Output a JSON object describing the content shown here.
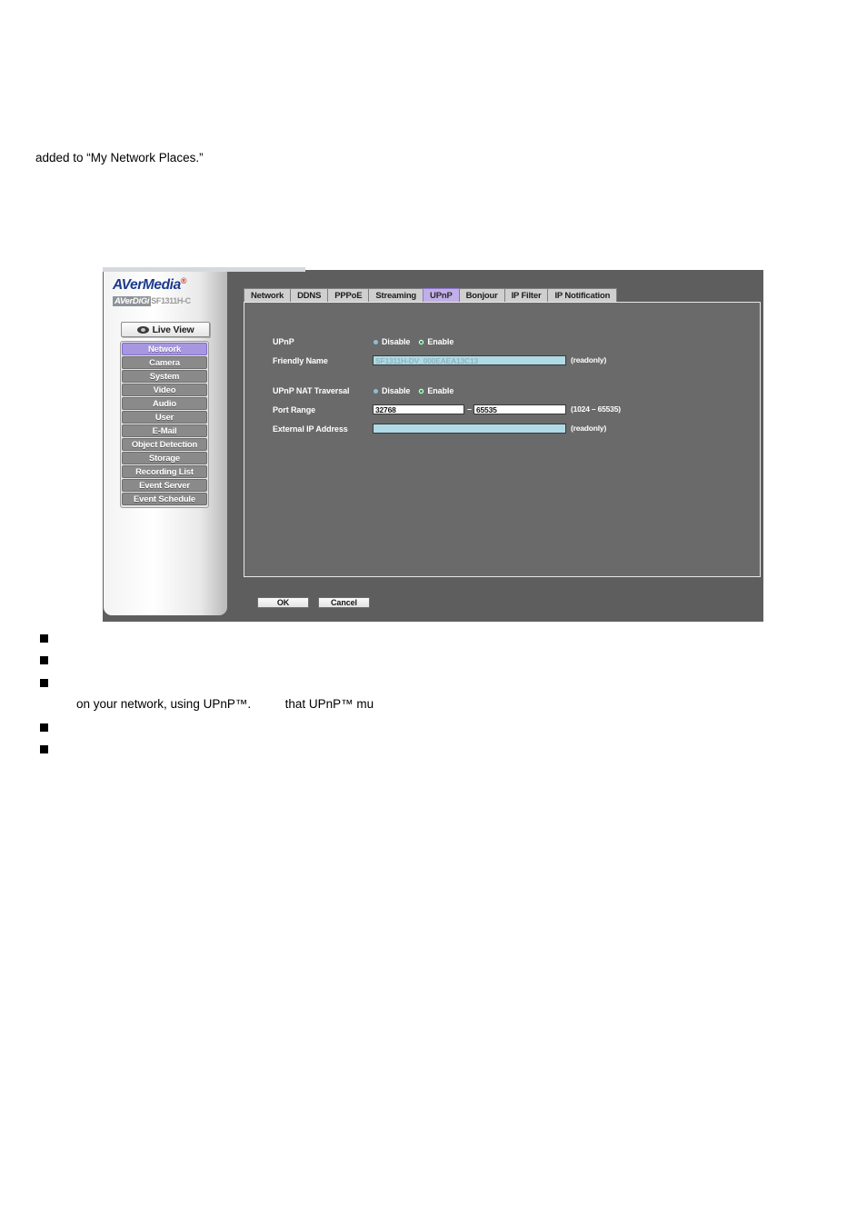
{
  "document": {
    "intro_text": "added to “My Network Places.”",
    "bullets": [
      {
        "text": ""
      },
      {
        "text": ""
      },
      {
        "text": ""
      },
      {
        "text": ""
      },
      {
        "text": ""
      }
    ],
    "continuation_line": "on your network, using UPnP™.          that UPnP™ mu"
  },
  "app": {
    "brand": {
      "name": "AVerMedia",
      "trademark": "®",
      "sub_brand": "AVerDiGi",
      "model": "SF1311H-C"
    },
    "live_view": {
      "label": "Live View",
      "icon": "eye-icon"
    },
    "nav": {
      "items": [
        {
          "label": "Network",
          "active": true
        },
        {
          "label": "Camera",
          "active": false
        },
        {
          "label": "System",
          "active": false
        },
        {
          "label": "Video",
          "active": false
        },
        {
          "label": "Audio",
          "active": false
        },
        {
          "label": "User",
          "active": false
        },
        {
          "label": "E-Mail",
          "active": false
        },
        {
          "label": "Object Detection",
          "active": false
        },
        {
          "label": "Storage",
          "active": false
        },
        {
          "label": "Recording List",
          "active": false
        },
        {
          "label": "Event Server",
          "active": false
        },
        {
          "label": "Event Schedule",
          "active": false
        }
      ]
    },
    "tabs": [
      {
        "label": "Network",
        "active": false
      },
      {
        "label": "DDNS",
        "active": false
      },
      {
        "label": "PPPoE",
        "active": false
      },
      {
        "label": "Streaming",
        "active": false
      },
      {
        "label": "UPnP",
        "active": true
      },
      {
        "label": "Bonjour",
        "active": false
      },
      {
        "label": "IP Filter",
        "active": false
      },
      {
        "label": "IP Notification",
        "active": false
      }
    ],
    "form": {
      "upnp": {
        "label": "UPnP",
        "disable_label": "Disable",
        "enable_label": "Enable",
        "selected": "Enable"
      },
      "friendly_name": {
        "label": "Friendly Name",
        "value": "SF1311H-DV_000EAEA13C13",
        "hint": "(readonly)"
      },
      "nat_traversal": {
        "label": "UPnP NAT Traversal",
        "disable_label": "Disable",
        "enable_label": "Enable",
        "selected": "Enable"
      },
      "port_range": {
        "label": "Port Range",
        "from": "32768",
        "separator": "–",
        "to": "65535",
        "hint": "(1024 – 65535)"
      },
      "external_ip": {
        "label": "External IP Address",
        "value": "",
        "hint": "(readonly)"
      }
    },
    "buttons": {
      "ok": "OK",
      "cancel": "Cancel"
    },
    "colors": {
      "accent_purple": "#a796e0",
      "tab_active": "#c2aee8",
      "panel_gray": "#6a6a6a",
      "window_gray": "#5e5e5e",
      "readonly_field": "#b0dbe6",
      "radio_checked_green": "#16a81e",
      "brand_blue": "#1b3a8c"
    }
  }
}
